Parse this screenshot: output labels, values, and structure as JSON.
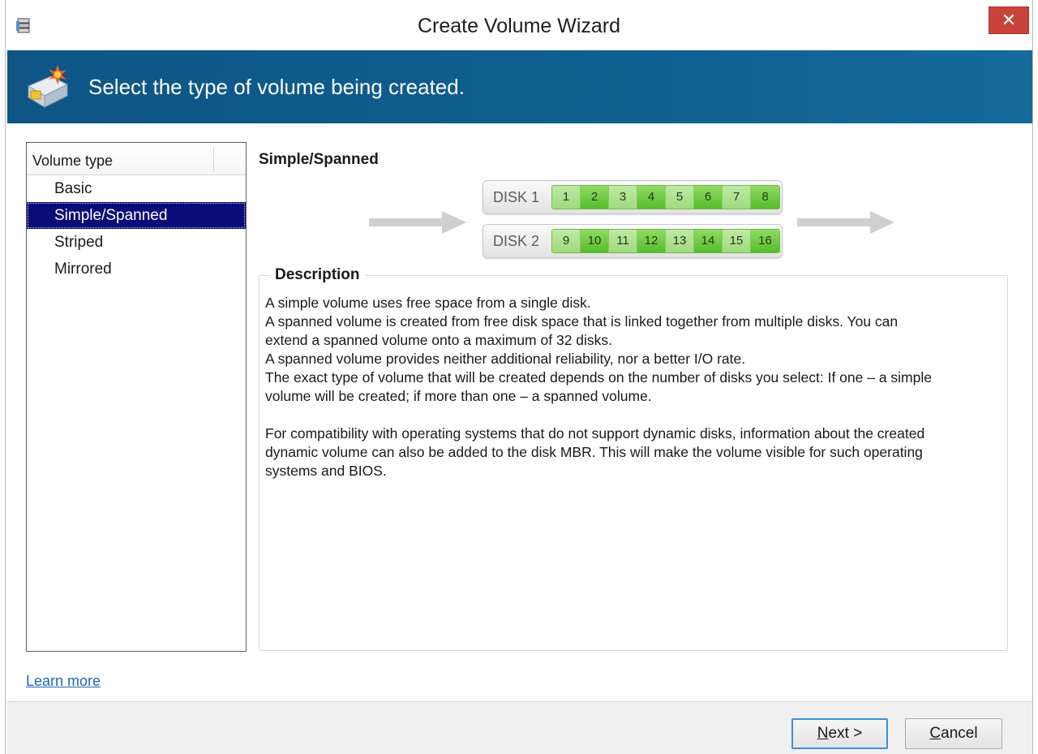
{
  "window": {
    "title": "Create Volume Wizard",
    "close_symbol": "✕"
  },
  "banner": {
    "text": "Select the type of volume being created."
  },
  "volume_list": {
    "header": "Volume type",
    "items": [
      {
        "label": "Basic",
        "selected": false
      },
      {
        "label": "Simple/Spanned",
        "selected": true
      },
      {
        "label": "Striped",
        "selected": false
      },
      {
        "label": "Mirrored",
        "selected": false
      }
    ]
  },
  "type_title": "Simple/Spanned",
  "diagram": {
    "disks": [
      {
        "label": "DISK 1",
        "cells": [
          "1",
          "2",
          "3",
          "4",
          "5",
          "6",
          "7",
          "8"
        ]
      },
      {
        "label": "DISK 2",
        "cells": [
          "9",
          "10",
          "11",
          "12",
          "13",
          "14",
          "15",
          "16"
        ]
      }
    ],
    "colors": {
      "cell_light": "#a8de88",
      "cell_dark": "#62c234",
      "arrow": "#cfcfcf"
    }
  },
  "description": {
    "legend": "Description",
    "lines": [
      "A simple volume uses free space from a single disk.",
      "A spanned volume is created from free disk space that is linked together from multiple disks. You can",
      "extend a spanned volume onto a maximum of 32 disks.",
      "A spanned volume provides neither additional reliability, nor a better I/O rate.",
      "The exact type of volume that will be created depends on the number of disks you select: If one – a simple",
      "volume will be created; if more than one – a spanned volume.",
      "",
      "For compatibility with operating systems that do not support dynamic disks, information about the created",
      "dynamic volume can also be added to the disk MBR. This will make the volume visible for such operating",
      "systems and BIOS."
    ]
  },
  "learn_more": "Learn more",
  "buttons": {
    "next_accel": "N",
    "next_rest": "ext >",
    "cancel_accel": "C",
    "cancel_rest": "ancel"
  },
  "colors": {
    "banner": "#0f5a8a",
    "selection": "#0b0c78",
    "close_button": "#c9433d",
    "link": "#1f66b8"
  }
}
